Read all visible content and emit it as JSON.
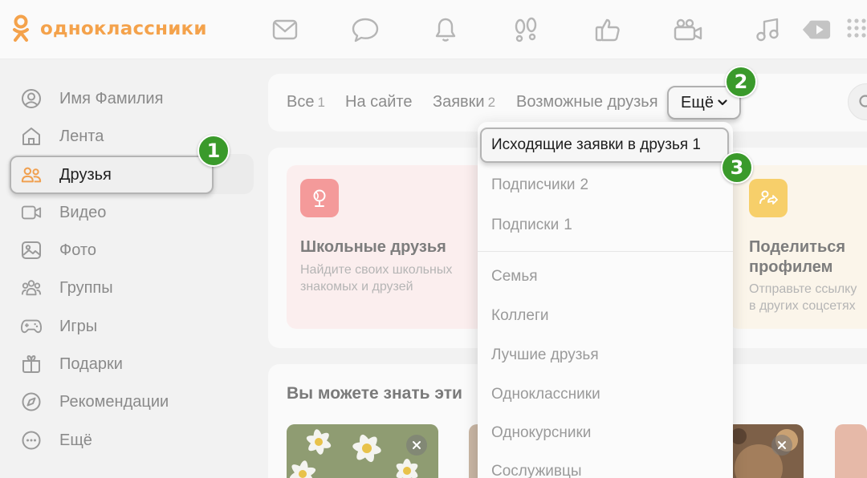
{
  "app": {
    "logo_text": "одноклассники",
    "brand_color": "#f4a24b"
  },
  "topbar": {
    "icons": [
      "mail-icon",
      "chat-icon",
      "bell-icon",
      "footprints-icon",
      "like-icon",
      "video-camera-icon",
      "music-icon",
      "video-showcase-icon",
      "apps-grid-icon"
    ]
  },
  "sidebar": {
    "items": [
      {
        "label": "Имя Фамилия",
        "icon": "user-icon"
      },
      {
        "label": "Лента",
        "icon": "home-icon"
      },
      {
        "label": "Друзья",
        "icon": "friends-icon",
        "active": true
      },
      {
        "label": "Видео",
        "icon": "video-icon"
      },
      {
        "label": "Фото",
        "icon": "photo-icon"
      },
      {
        "label": "Группы",
        "icon": "groups-icon"
      },
      {
        "label": "Игры",
        "icon": "gamepad-icon"
      },
      {
        "label": "Подарки",
        "icon": "gift-icon"
      },
      {
        "label": "Рекомендации",
        "icon": "compass-icon"
      },
      {
        "label": "Ещё",
        "icon": "more-dots-icon"
      }
    ]
  },
  "tabs": {
    "all_label": "Все",
    "all_count": "1",
    "online_label": "На сайте",
    "requests_label": "Заявки",
    "requests_count": "2",
    "possible_label": "Возможные друзья",
    "more_label": "Ещё"
  },
  "promo": {
    "school_title": "Школьные друзья",
    "school_desc_1": "Найдите своих школьных",
    "school_desc_2": "знакомых и друзей",
    "share_title_1": "Поделиться",
    "share_title_2": "профилем",
    "share_desc_1": "Отправьте ссылку",
    "share_desc_2": "в других соцсетях"
  },
  "people": {
    "heading": "Вы можете знать эти"
  },
  "dropdown": {
    "outgoing": "Исходящие заявки в друзья 1",
    "subscribers_label": "Подписчики",
    "subscribers_count": "2",
    "subscriptions_label": "Подписки",
    "subscriptions_count": "1",
    "family": "Семья",
    "colleagues": "Коллеги",
    "best_friends": "Лучшие друзья",
    "classmates": "Одноклассники",
    "groupmates": "Однокурсники",
    "coworkers": "Сослуживцы"
  },
  "badges": {
    "one": "1",
    "two": "2",
    "three": "3",
    "color": "#3a9a2b"
  }
}
